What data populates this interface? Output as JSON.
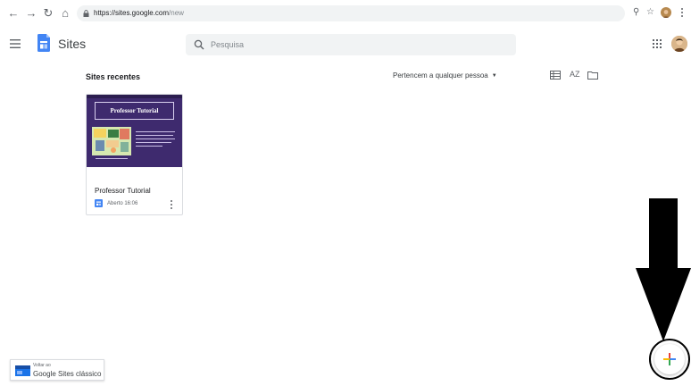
{
  "browser": {
    "url_host": "https://sites.google.com",
    "url_path": "/new"
  },
  "header": {
    "app_name": "Sites",
    "search_placeholder": "Pesquisa"
  },
  "recent": {
    "section_title": "Sites recentes",
    "owner_filter": "Pertencem a qualquer pessoa",
    "sort_label": "AZ"
  },
  "site_card": {
    "thumbnail_title": "Professor Tutorial",
    "title": "Professor Tutorial",
    "meta": "Aberto 16:06"
  },
  "classic_link": {
    "sub_label": "Voltar ao",
    "label": "Google Sites clássico"
  },
  "colors": {
    "sites_blue": "#4285f4",
    "thumbnail_purple": "#3e2a6e",
    "fab_red": "#ea4335",
    "fab_blue": "#4285f4",
    "fab_yellow": "#fbbc04",
    "fab_green": "#34a853"
  },
  "icons": {
    "back": "arrow-left-icon",
    "forward": "arrow-right-icon",
    "reload": "reload-icon",
    "home": "home-icon",
    "lock": "lock-icon",
    "zoom": "zoom-icon",
    "bookmark": "star-icon",
    "menu": "hamburger-icon",
    "search": "search-icon",
    "apps": "apps-grid-icon",
    "list_view": "list-view-icon",
    "sort": "sort-az-icon",
    "folder": "folder-icon",
    "more": "more-vert-icon",
    "create": "plus-icon"
  }
}
